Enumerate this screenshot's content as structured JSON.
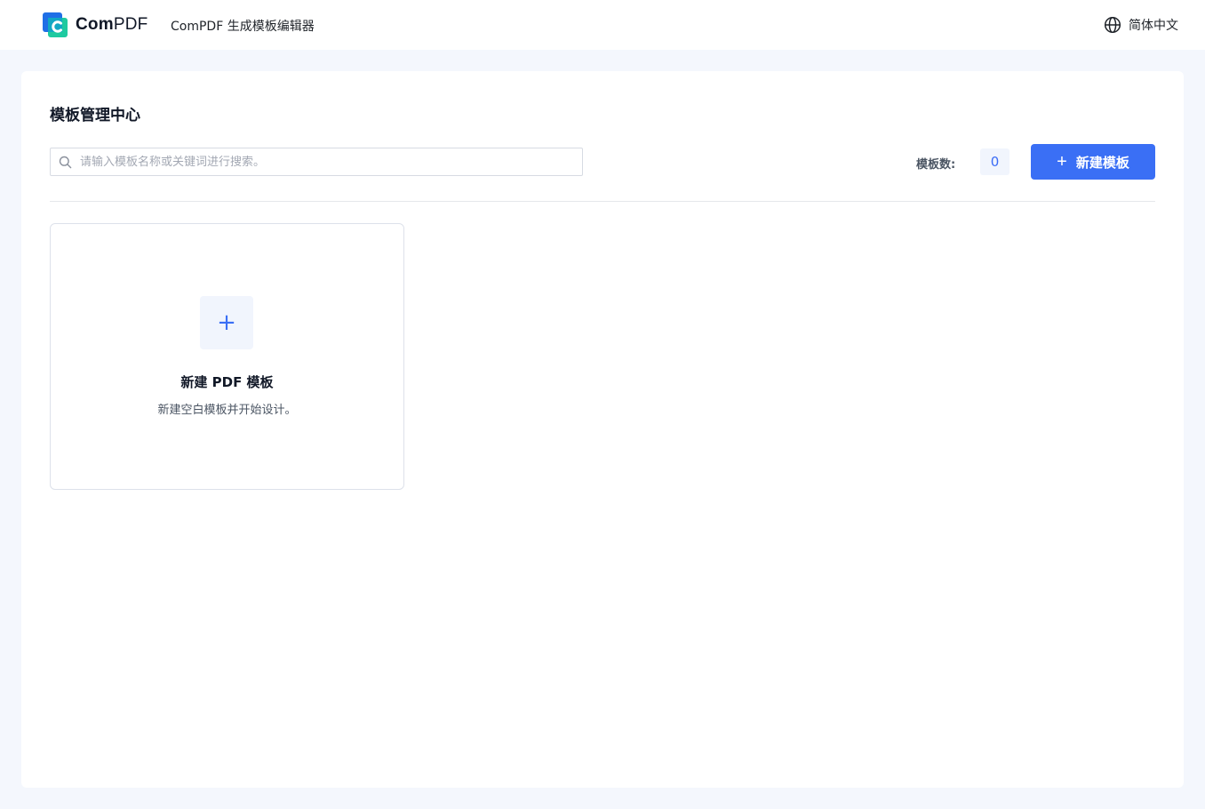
{
  "header": {
    "logo_brand": "ComPDF",
    "logo_brand_part1": "Com",
    "logo_brand_part2": "PDF",
    "app_title": "ComPDF 生成模板编辑器",
    "language_label": "简体中文",
    "language_icon": "globe-icon"
  },
  "main": {
    "page_title": "模板管理中心",
    "search": {
      "placeholder": "请输入模板名称或关键词进行搜索。",
      "value": "",
      "icon": "search-icon"
    },
    "template_count_label": "模板数:",
    "template_count": "0",
    "new_template_button": {
      "icon": "plus-icon",
      "label": "新建模板"
    },
    "new_card": {
      "icon": "plus-icon",
      "title": "新建 PDF 模板",
      "description": "新建空白模板并开始设计。"
    }
  },
  "colors": {
    "accent": "#3a6ff5",
    "background": "#f4f7fd",
    "logo_blue": "#1f6fe6",
    "logo_teal": "#1ecaa0"
  }
}
